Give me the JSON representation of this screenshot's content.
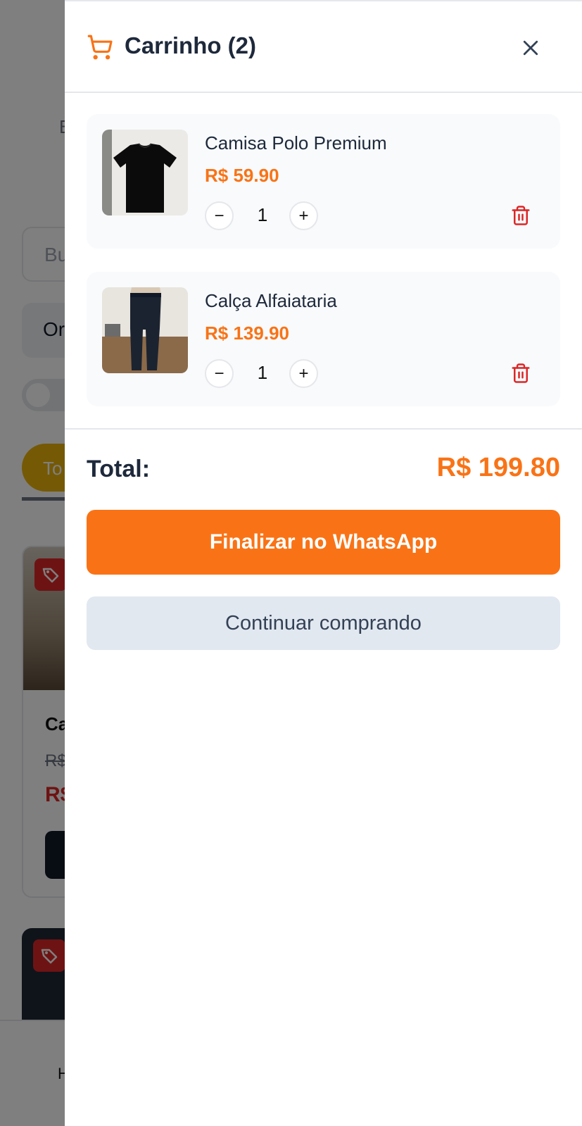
{
  "background": {
    "letter": "B",
    "search_placeholder": "Bu",
    "order_text": "Or",
    "chip_text": "To",
    "card_title": "Ca",
    "card_old_price": "R$",
    "card_price": "R$",
    "nav_text": "H"
  },
  "cart": {
    "title": "Carrinho (2)",
    "items": [
      {
        "name": "Camisa Polo Premium",
        "price": "R$ 59.90",
        "quantity": "1"
      },
      {
        "name": "Calça Alfaiataria",
        "price": "R$ 139.90",
        "quantity": "1"
      }
    ],
    "total_label": "Total:",
    "total_value": "R$ 199.80",
    "checkout_label": "Finalizar no WhatsApp",
    "continue_label": "Continuar comprando",
    "minus_symbol": "−",
    "plus_symbol": "+"
  },
  "colors": {
    "accent": "#f97316",
    "danger": "#dc2626",
    "text": "#1e293b",
    "secondary_bg": "#e2e8f0"
  },
  "icons": [
    "cart-icon",
    "close-icon",
    "trash-icon",
    "tag-icon"
  ]
}
